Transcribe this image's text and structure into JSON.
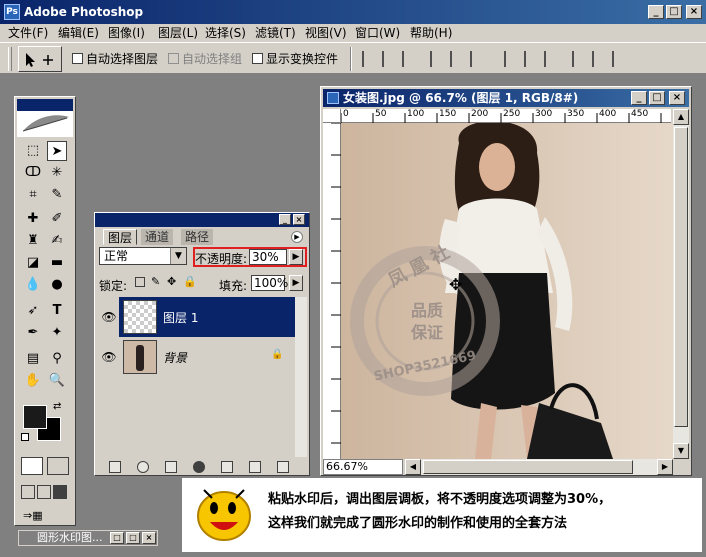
{
  "app": {
    "title": "Adobe Photoshop",
    "logo_text": "Ps"
  },
  "window_controls": {
    "minimize": "_",
    "maximize": "□",
    "close": "×"
  },
  "menu": [
    "文件(F)",
    "编辑(E)",
    "图像(I)",
    "图层(L)",
    "选择(S)",
    "滤镜(T)",
    "视图(V)",
    "窗口(W)",
    "帮助(H)"
  ],
  "options": {
    "auto_select_layer": "自动选择图层",
    "auto_select_group": "自动选择组",
    "show_transform": "显示变换控件"
  },
  "layers_panel": {
    "tabs": [
      "图层",
      "通道",
      "路径"
    ],
    "blend_mode": "正常",
    "opacity_label": "不透明度:",
    "opacity_value": "30%",
    "lock_label": "锁定:",
    "fill_label": "填充:",
    "fill_value": "100%",
    "layers": [
      {
        "name": "图层 1",
        "selected": true
      },
      {
        "name": "背景",
        "selected": false
      }
    ]
  },
  "document": {
    "title": "女装图.jpg @ 66.7% (图层 1, RGB/8#)",
    "zoom": "66.67%",
    "ruler_ticks": [
      "0",
      "50",
      "100",
      "150",
      "200",
      "250",
      "300",
      "350",
      "400",
      "450"
    ],
    "watermark": {
      "arc_text": "凤凰社",
      "center_line1": "品质",
      "center_line2": "保证",
      "bottom_text": "SHOP3521669"
    }
  },
  "minimized_window": {
    "title": "圆形水印图..."
  },
  "caption": {
    "line1": "粘贴水印后，调出图层调板，将不透明度选项调整为30%，",
    "line2": "这样我们就完成了圆形水印的制作和使用的全套方法"
  },
  "colors": {
    "title_bar": "#0a246a",
    "chrome": "#d4d0c8",
    "workspace": "#808080",
    "highlight_border": "#e02020",
    "selected_layer": "#0a246a"
  }
}
